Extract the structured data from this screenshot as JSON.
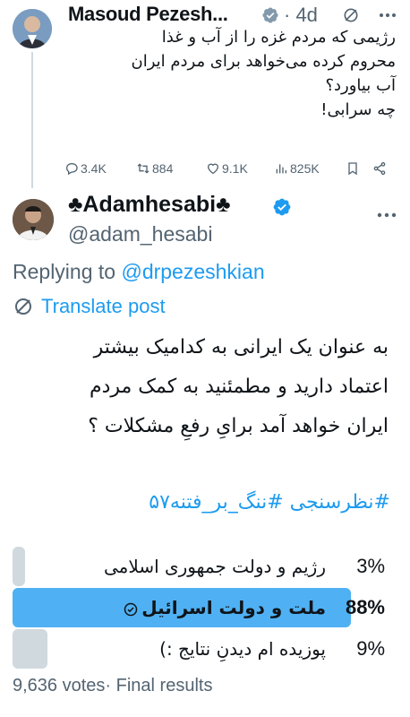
{
  "parent_tweet": {
    "author_name": "Masoud Pezesh...",
    "time": "· 4d",
    "text_lines": [
      "رژیمی که مردم غزه را از آب و غذا",
      "محروم کرده می‌خواهد برای مردم ایران",
      "آب بیاورد؟",
      "چه سرابی!"
    ],
    "actions": {
      "replies": "3.4K",
      "reposts": "884",
      "likes": "9.1K",
      "views": "825K"
    }
  },
  "reply_tweet": {
    "author_name": "♣Adamhesabi♣",
    "handle": "@adam_hesabi",
    "replying_prefix": "Replying to",
    "replying_to": "@drpezeshkian",
    "translate_label": "Translate post",
    "text_lines": [
      "به عنوان یک ایرانی به کدامیک بیشتر",
      "اعتماد دارید و مطمئنید به کمک مردم",
      "ایران خواهد آمد برایِ رفعِ مشکلات ؟"
    ],
    "hashtags": "#نظرسنجی #ننگ_بر_فتنه۵۷"
  },
  "poll": {
    "options": [
      {
        "label": "رژیم و دولت جمهوری اسلامی",
        "percent": "3%",
        "value": 3,
        "winner": false
      },
      {
        "label": "ملت و دولت اسرائیل",
        "percent": "88%",
        "value": 88,
        "winner": true
      },
      {
        "label": "پوزیده ام دیدنِ نتایج :)",
        "percent": "9%",
        "value": 9,
        "winner": false
      }
    ],
    "votes": "9,636 votes",
    "status": "· Final results"
  },
  "colors": {
    "accent": "#1d9bf0",
    "secondary_text": "#536471",
    "poll_winner_bar": "#4fb1f3",
    "poll_bar": "#cfd9de"
  }
}
